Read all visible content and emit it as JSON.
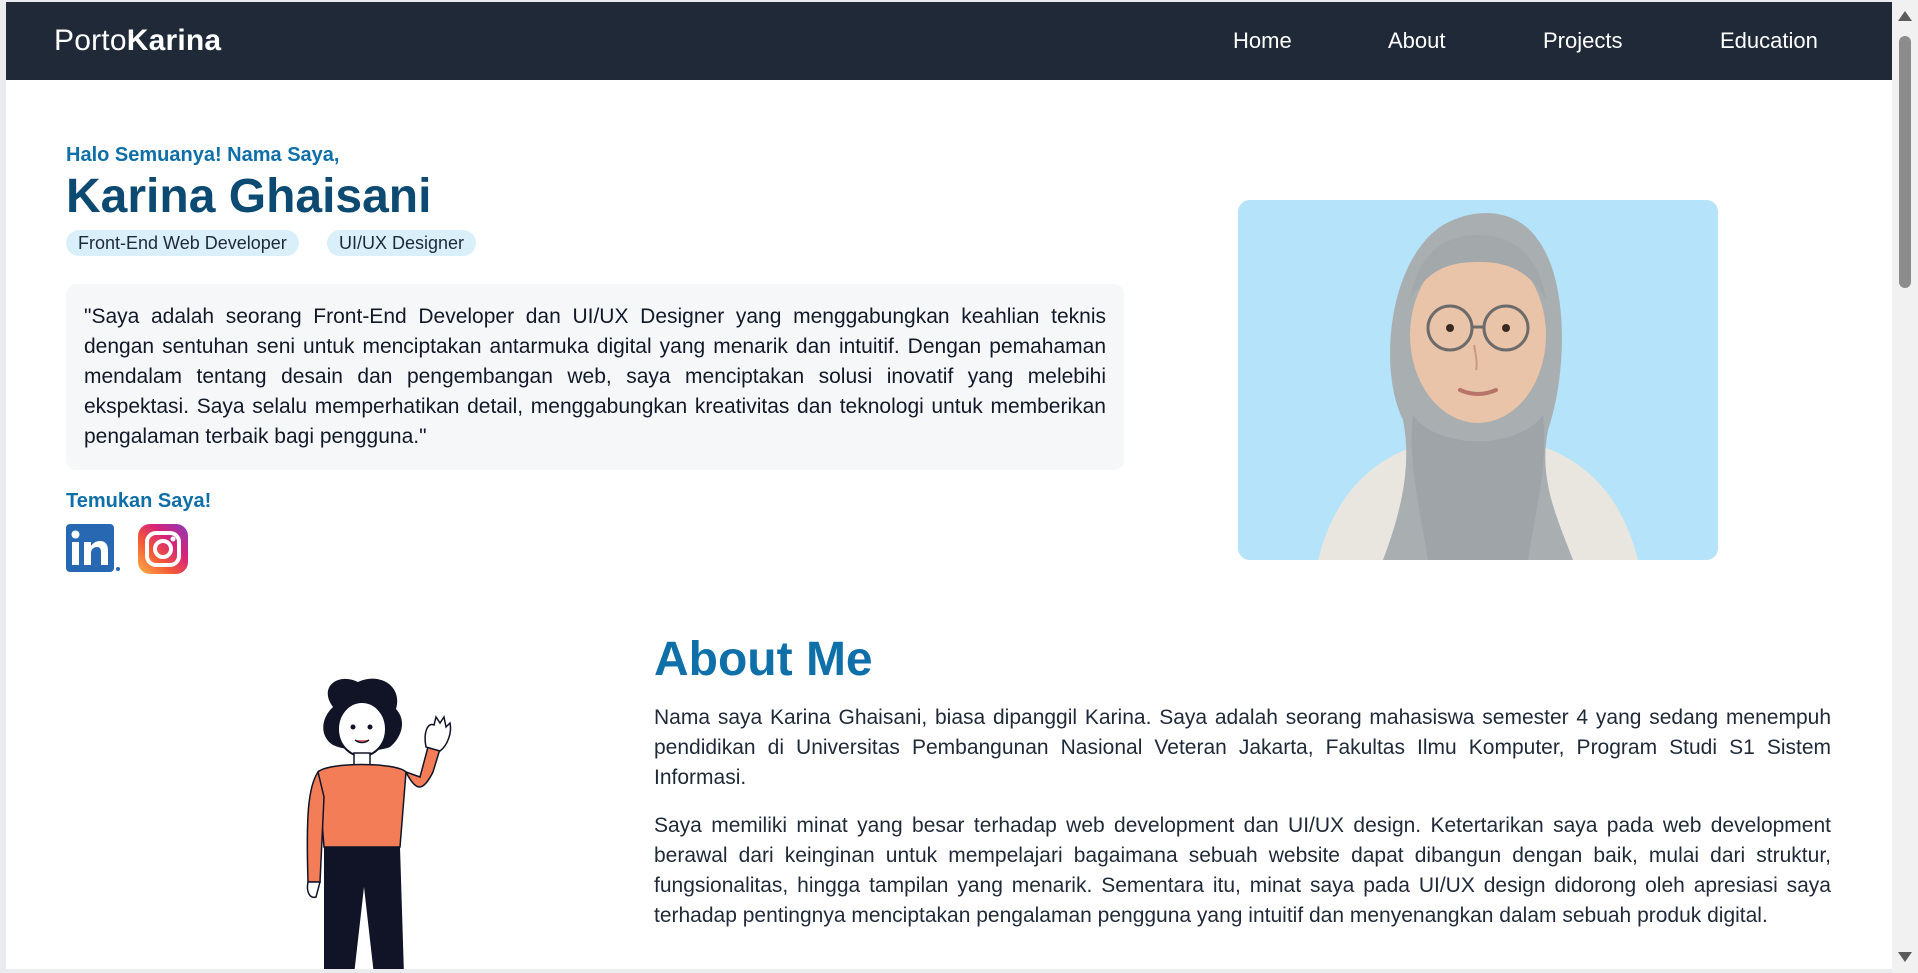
{
  "navbar": {
    "brand_prefix": "Porto",
    "brand_suffix": "Karina",
    "links": [
      "Home",
      "About",
      "Projects",
      "Education"
    ],
    "bg_color": "#1f2937"
  },
  "hero": {
    "greeting": "Halo Semuanya! Nama Saya,",
    "name": "Karina Ghaisani",
    "tags": [
      "Front-End Web Developer",
      "UI/UX Designer"
    ],
    "quote": "\"Saya adalah seorang Front-End Developer dan UI/UX Designer yang menggabungkan keahlian teknis dengan sentuhan seni untuk menciptakan antarmuka digital yang menarik dan intuitif. Dengan pemahaman mendalam tentang desain dan pengembangan web, saya menciptakan solusi inovatif yang melebihi ekspektasi. Saya selalu memperhatikan detail, menggabungkan kreativitas dan teknologi untuk memberikan pengalaman terbaik bagi pengguna.\"",
    "find_me": "Temukan Saya!",
    "social_icons": [
      "linkedin-icon",
      "instagram-icon"
    ],
    "accent_color": "#0f6fa8",
    "name_color": "#0c4a72"
  },
  "about": {
    "title": "About Me",
    "paragraph_1": "Nama saya Karina Ghaisani, biasa dipanggil Karina. Saya adalah seorang mahasiswa semester 4 yang sedang menempuh pendidikan di Universitas Pembangunan Nasional Veteran Jakarta, Fakultas Ilmu Komputer, Program Studi S1 Sistem Informasi.",
    "paragraph_2": "Saya memiliki minat yang besar terhadap web development dan UI/UX design. Ketertarikan saya pada web development berawal dari keinginan untuk mempelajari bagaimana sebuah website dapat dibangun dengan baik, mulai dari struktur, fungsionalitas, hingga tampilan yang menarik. Sementara itu, minat saya pada UI/UX design didorong oleh apresiasi saya terhadap pentingnya menciptakan pengalaman pengguna yang intuitif dan menyenangkan dalam sebuah produk digital."
  }
}
